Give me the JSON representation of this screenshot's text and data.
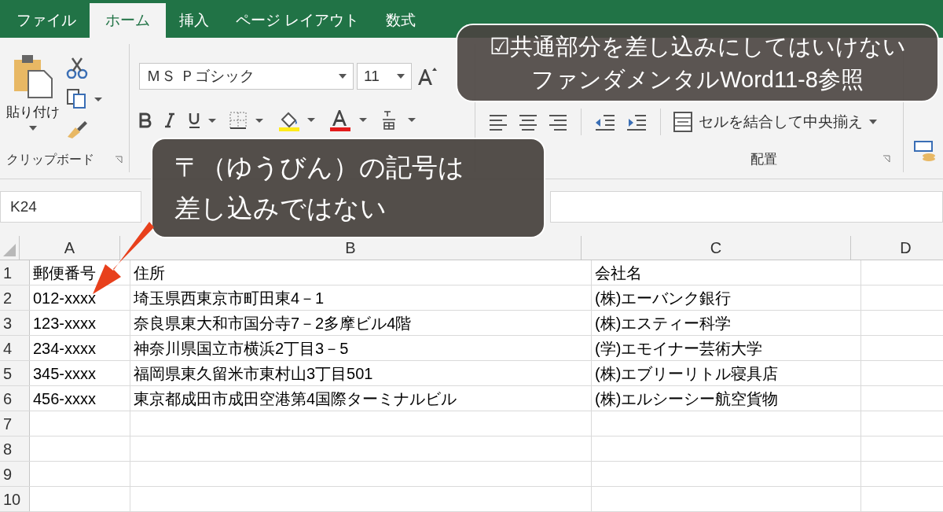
{
  "ribbon_tabs": [
    {
      "label": "ファイル",
      "selected": false
    },
    {
      "label": "ホーム",
      "selected": true
    },
    {
      "label": "挿入",
      "selected": false
    },
    {
      "label": "ページ レイアウト",
      "selected": false
    },
    {
      "label": "数式",
      "selected": false
    }
  ],
  "clipboard": {
    "paste_label": "貼り付け",
    "group_label": "クリップボード"
  },
  "font": {
    "name": "ＭＳ Ｐゴシック",
    "size": "11"
  },
  "alignment": {
    "merge_label": "セルを結合して中央揃え",
    "group_label": "配置"
  },
  "name_box": "K24",
  "sheet": {
    "columns": [
      "A",
      "B",
      "C",
      "D"
    ],
    "rows": [
      {
        "number": "1",
        "cells": [
          "郵便番号",
          "住所",
          "会社名"
        ]
      },
      {
        "number": "2",
        "cells": [
          "012-xxxx",
          "埼玉県西東京市町田東4－1",
          "(株)エーバンク銀行"
        ]
      },
      {
        "number": "3",
        "cells": [
          "123-xxxx",
          "奈良県東大和市国分寺7－2多摩ビル4階",
          "(株)エスティー科学"
        ]
      },
      {
        "number": "4",
        "cells": [
          "234-xxxx",
          "神奈川県国立市横浜2丁目3－5",
          "(学)エモイナー芸術大学"
        ]
      },
      {
        "number": "5",
        "cells": [
          "345-xxxx",
          "福岡県東久留米市東村山3丁目501",
          "(株)エブリーリトル寝具店"
        ]
      },
      {
        "number": "6",
        "cells": [
          "456-xxxx",
          "東京都成田市成田空港第4国際ターミナルビル",
          "(株)エルシーシー航空貨物"
        ]
      },
      {
        "number": "7"
      },
      {
        "number": "8"
      },
      {
        "number": "9"
      },
      {
        "number": "10"
      }
    ]
  },
  "callouts": [
    {
      "lines": [
        "☑共通部分を差し込みにしてはいけない",
        "ファンダメンタルWord11-8参照"
      ]
    },
    {
      "lines": [
        "〒（ゆうびん）の記号は",
        "差し込みではない"
      ]
    }
  ]
}
